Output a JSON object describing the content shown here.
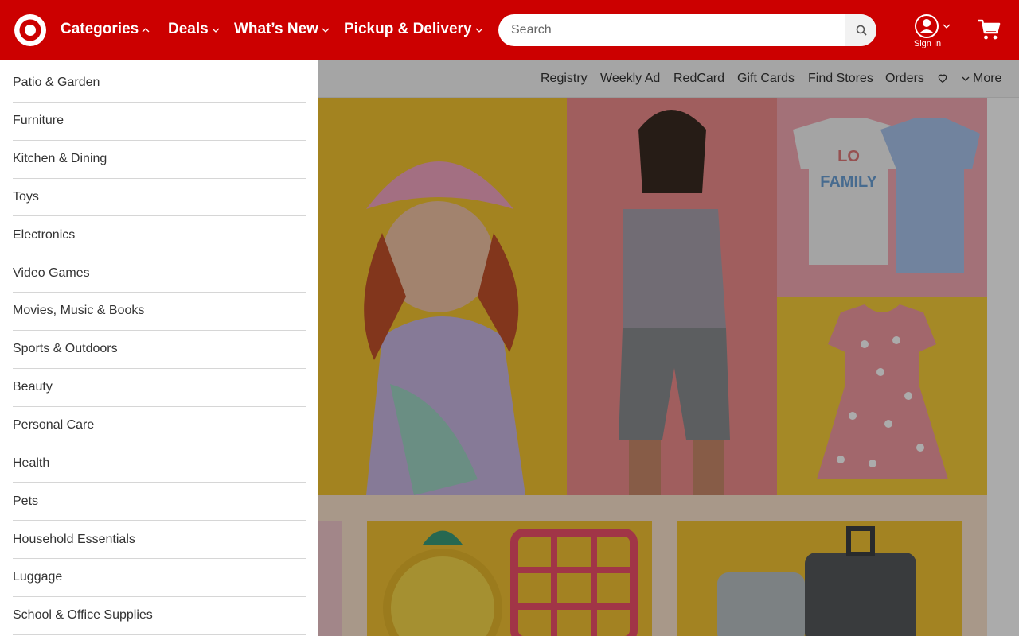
{
  "header": {
    "nav": [
      {
        "label": "Categories",
        "chevron": "up"
      },
      {
        "label": "Deals",
        "chevron": "down"
      },
      {
        "label": "What’s New",
        "chevron": "down"
      },
      {
        "label": "Pickup & Delivery",
        "chevron": "down"
      }
    ],
    "search": {
      "placeholder": "Search"
    },
    "signin_label": "Sign In"
  },
  "utility": {
    "links": [
      "Registry",
      "Weekly Ad",
      "RedCard",
      "Gift Cards",
      "Find Stores",
      "Orders"
    ],
    "more_label": "More"
  },
  "categories": [
    "Patio & Garden",
    "Furniture",
    "Kitchen & Dining",
    "Toys",
    "Electronics",
    "Video Games",
    "Movies, Music & Books",
    "Sports & Outdoors",
    "Beauty",
    "Personal Care",
    "Health",
    "Pets",
    "Household Essentials",
    "Luggage",
    "School & Office Supplies"
  ],
  "colors": {
    "brand": "#cc0000",
    "text": "#333333"
  },
  "icons": [
    "bullseye-logo-icon",
    "chevron-up-icon",
    "chevron-down-icon",
    "search-icon",
    "account-icon",
    "cart-icon",
    "heart-icon"
  ]
}
